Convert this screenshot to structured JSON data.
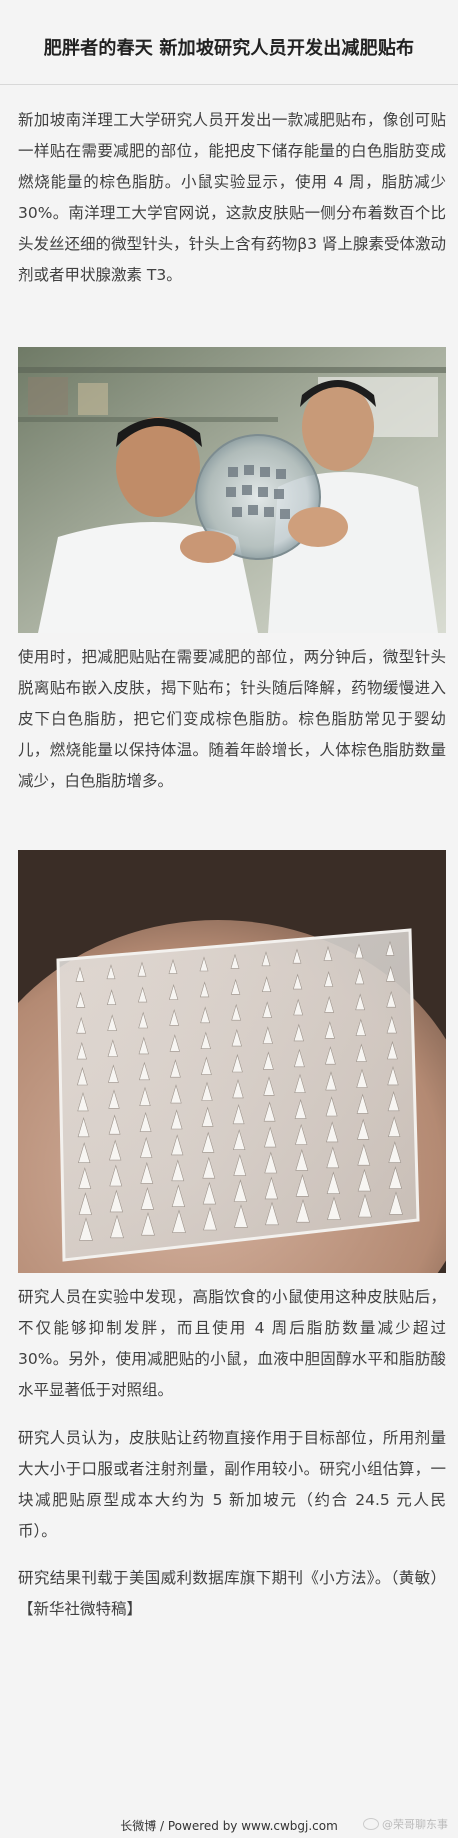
{
  "article": {
    "title": "肥胖者的春天 新加坡研究人员开发出减肥贴布",
    "paragraphs": [
      "新加坡南洋理工大学研究人员开发出一款减肥贴布，像创可贴一样贴在需要减肥的部位，能把皮下储存能量的白色脂肪变成燃烧能量的棕色脂肪。小鼠实验显示，使用 4 周，脂肪减少 30%。南洋理工大学官网说，这款皮肤贴一侧分布着数百个比头发丝还细的微型针头，针头上含有药物β3 肾上腺素受体激动剂或者甲状腺激素 T3。",
      "使用时，把减肥贴贴在需要减肥的部位，两分钟后，微型针头脱离贴布嵌入皮肤，揭下贴布；针头随后降解，药物缓慢进入皮下白色脂肪，把它们变成棕色脂肪。棕色脂肪常见于婴幼儿，燃烧能量以保持体温。随着年龄增长，人体棕色脂肪数量减少，白色脂肪增多。",
      "研究人员在实验中发现，高脂饮食的小鼠使用这种皮肤贴后，不仅能够抑制发胖，而且使用 4 周后脂肪数量减少超过 30%。另外，使用减肥贴的小鼠，血液中胆固醇水平和脂肪酸水平显著低于对照组。",
      "研究人员认为，皮肤贴让药物直接作用于目标部位，所用剂量大大小于口服或者注射剂量，副作用较小。研究小组估算，一块减肥贴原型成本大约为 5 新加坡元（约合 24.5 元人民币）。",
      "研究结果刊载于美国威利数据库旗下期刊《小方法》。（黄敏）【新华社微特稿】"
    ]
  },
  "footer": {
    "text": "长微博 / Powered by www.cwbgj.com",
    "watermark": "@荣哥聊东事"
  }
}
